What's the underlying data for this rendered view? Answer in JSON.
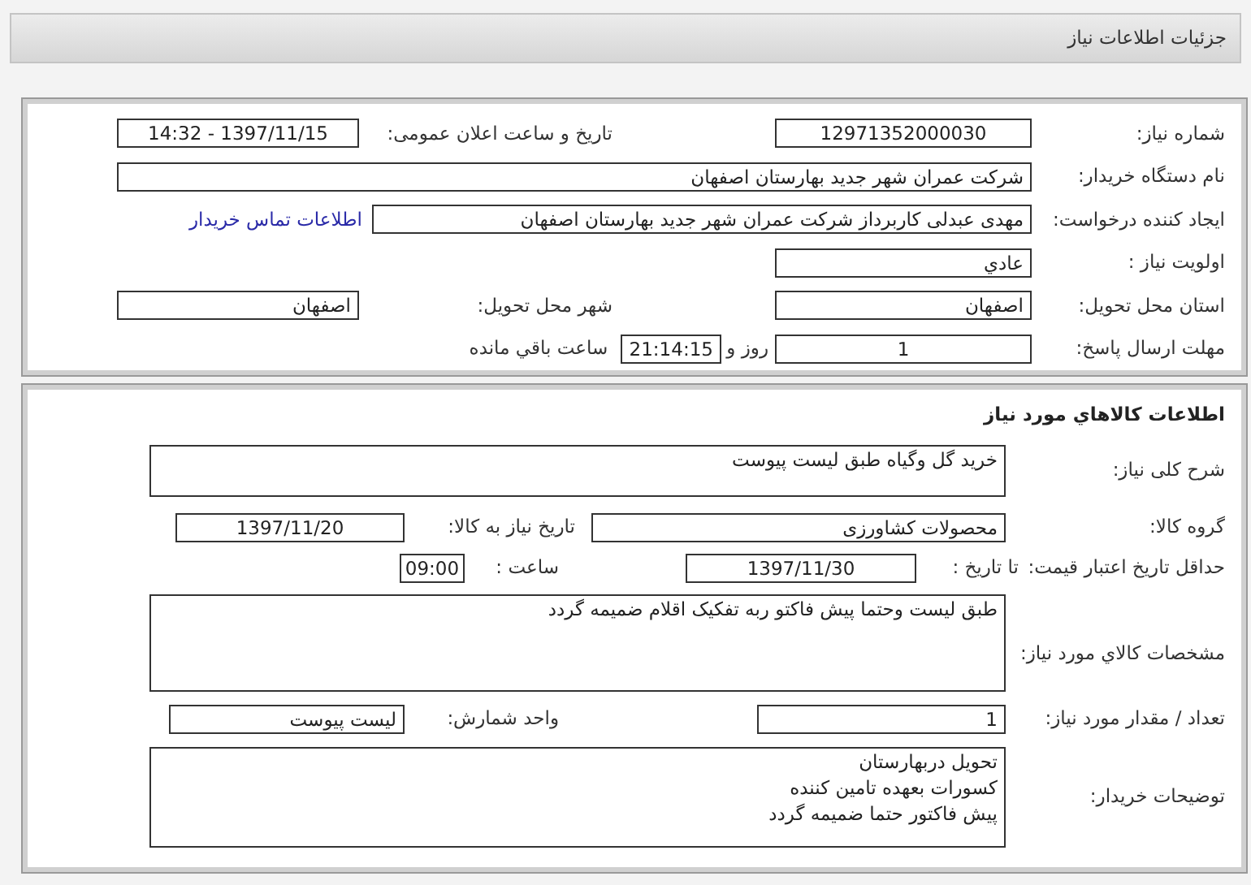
{
  "page_title": "جزئیات اطلاعات نیاز",
  "request": {
    "need_number": {
      "label": "شماره نیاز:",
      "value": "12971352000030"
    },
    "announce_datetime": {
      "label": "تاریخ و ساعت اعلان عمومی:",
      "value": "1397/11/15 - 14:32"
    },
    "buyer_org": {
      "label": "نام دستگاه خریدار:",
      "value": "شرکت عمران شهر جدید بهارستان اصفهان"
    },
    "requester": {
      "label": "ایجاد کننده درخواست:",
      "value": "مهدی عبدلی کاربرداز شرکت عمران شهر جدید بهارستان اصفهان"
    },
    "buyer_contact_link": "اطلاعات تماس خریدار",
    "priority": {
      "label": "اولویت نیاز :",
      "value": "عادي"
    },
    "delivery_province": {
      "label": "استان محل تحویل:",
      "value": "اصفهان"
    },
    "delivery_city": {
      "label": "شهر محل تحویل:",
      "value": "اصفهان"
    },
    "reply_deadline": {
      "label": "مهلت ارسال پاسخ:",
      "days": "1",
      "days_label": "روز و",
      "time": "21:14:15",
      "remaining_label": "ساعت باقي مانده"
    }
  },
  "goods": {
    "title": "اطلاعات كالاهاي مورد نياز",
    "description": {
      "label": "شرح کلی نیاز:",
      "value": "خرید گل وگیاه طبق لیست پیوست"
    },
    "goods_group": {
      "label": "گروه کالا:",
      "value": "محصولات کشاورزی"
    },
    "need_date": {
      "label": "تاریخ نیاز به کالا:",
      "value": "1397/11/20"
    },
    "price_validity": {
      "label": "حداقل تاریخ اعتبار قیمت:",
      "date_label": "تا تاریخ :",
      "date": "1397/11/30",
      "time_label": "ساعت :",
      "time": "09:00"
    },
    "specs": {
      "label": "مشخصات كالاي مورد نياز:",
      "value": "طبق لیست وحتما پیش فاکتو ربه تفکیک اقلام ضمیمه گردد"
    },
    "quantity": {
      "label": "تعداد / مقدار مورد نیاز:",
      "value": "1"
    },
    "unit": {
      "label": "واحد شمارش:",
      "value": "لیست پیوست"
    },
    "buyer_notes": {
      "label": "توضیحات خریدار:",
      "lines": [
        "تحویل دربهارستان",
        "کسورات بعهده تامین کننده",
        "پیش فاکتور حتما ضمیمه گردد"
      ]
    }
  }
}
